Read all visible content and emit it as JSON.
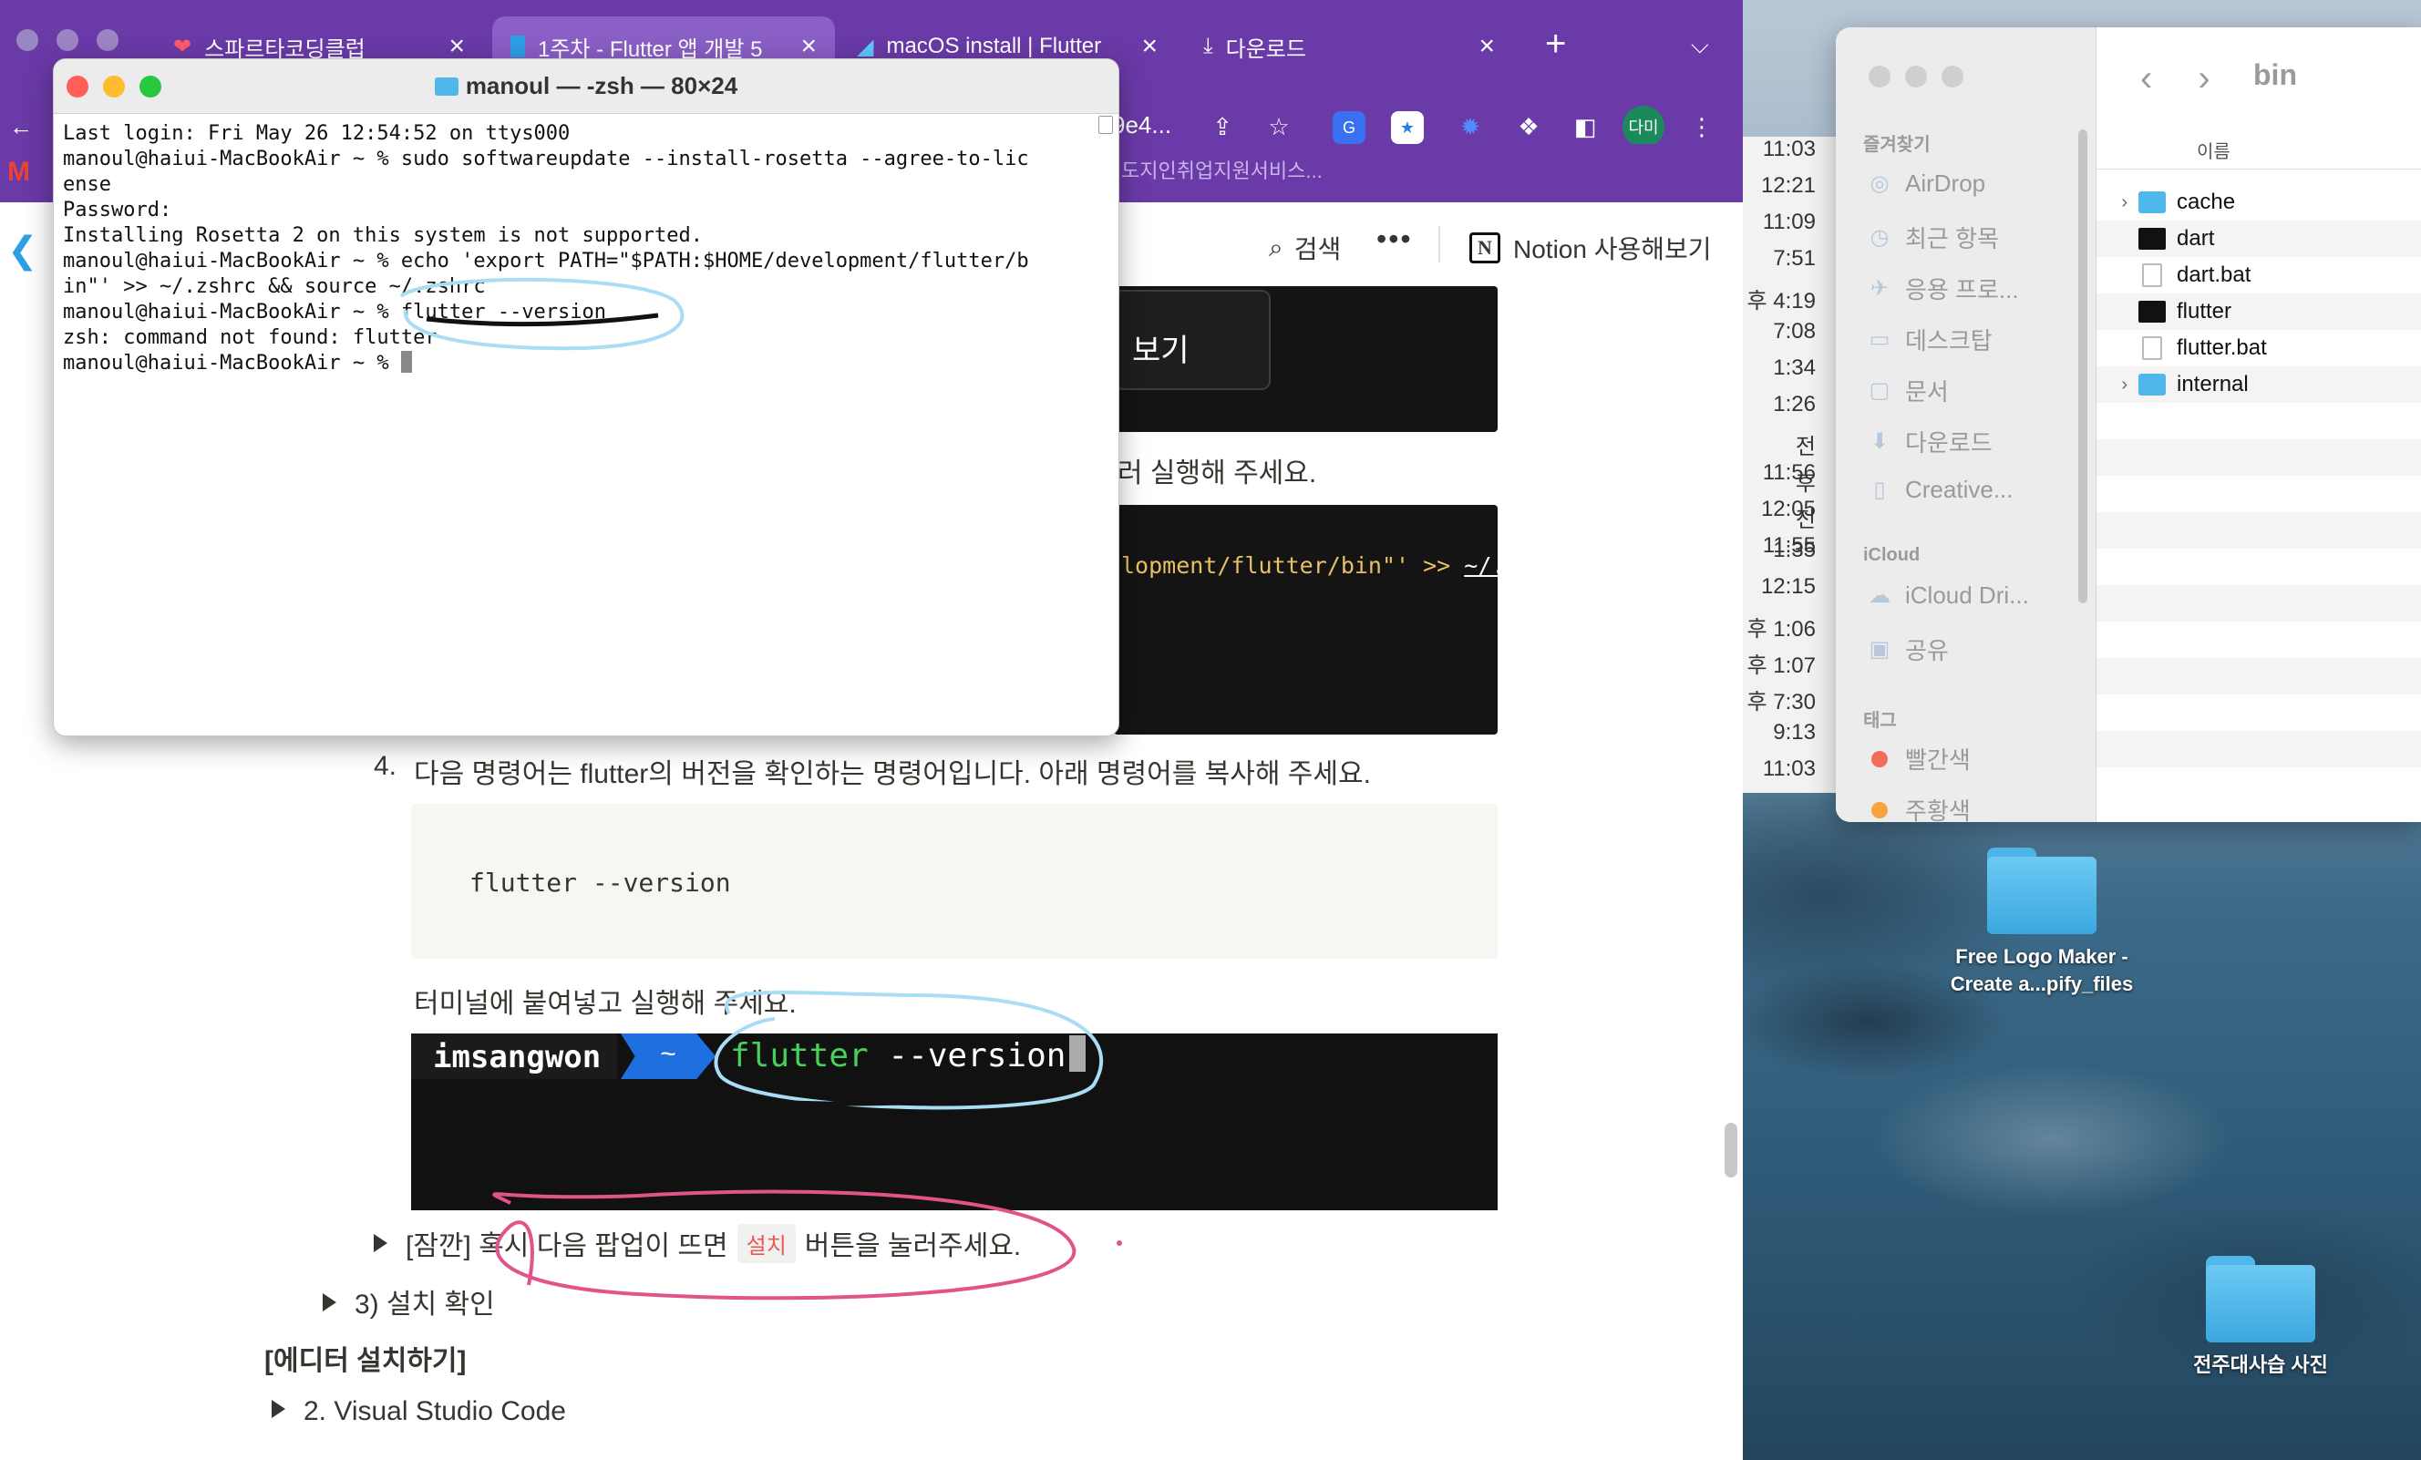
{
  "browser": {
    "tabs": [
      {
        "label": "스파르타코딩클럽",
        "icon": "sparta-icon"
      },
      {
        "label": "1주차 - Flutter 앱 개발 5",
        "icon": "notion-page-icon"
      },
      {
        "label": "macOS install | Flutter",
        "icon": "flutter-icon"
      },
      {
        "label": "다운로드",
        "icon": "download-icon"
      }
    ],
    "address_fragment": "9e4...",
    "profile_label": "다미",
    "bookmark_text": "도지인취업지원서비스..."
  },
  "notion": {
    "topbar": {
      "search_label": "검색",
      "more_label": "•••",
      "notion_label": "Notion 사용해보기",
      "notion_logo": "N"
    },
    "popup_button": "보기",
    "run_text_fragment": "러 실행해 주세요.",
    "code_fragment_1": "lopment/flutter/bin\"' >> ",
    "code_fragment_2": "~/.",
    "step4_number": "4.",
    "step4_text": "다음 명령어는 flutter의 버전을 확인하는 명령어입니다. 아래 명령어를 복사해 주세요.",
    "code_block": "flutter --version",
    "paste_text": "터미널에 붙여넣고 실행해 주세요.",
    "prompt_user": "imsangwon",
    "prompt_dir": "~",
    "prompt_cmd_1": "flutter",
    "prompt_cmd_2": " --version",
    "toggle_popup_text_1": "[잠깐] 혹시 다음 팝업이 뜨면",
    "toggle_popup_code": "설치",
    "toggle_popup_text_2": "버튼을 눌러주세요.",
    "toggle_install_check": "3) 설치 확인",
    "editor_heading": "[에디터 설치하기]",
    "toggle_vscode": "2. Visual Studio Code"
  },
  "history_times": [
    "11:03",
    "12:21",
    "11:09",
    "7:51",
    "후 4:19",
    "7:08",
    "1:34",
    "1:26",
    "전 11:56",
    "후 12:05",
    "전 11:55",
    "1:35",
    "12:15",
    "후 1:06",
    "후 1:07",
    "후 7:30",
    "9:13",
    "11:03"
  ],
  "terminal": {
    "title": "manoul — -zsh — 80×24",
    "lines": [
      "Last login: Fri May 26 12:54:52 on ttys000",
      "manoul@haiui-MacBookAir ~ % sudo softwareupdate --install-rosetta --agree-to-lic",
      "ense",
      "Password:",
      "Installing Rosetta 2 on this system is not supported.",
      "manoul@haiui-MacBookAir ~ % echo 'export PATH=\"$PATH:$HOME/development/flutter/b",
      "in\"' >> ~/.zshrc && source ~/.zshrc",
      "manoul@haiui-MacBookAir ~ % flutter --version",
      "zsh: command not found: flutter",
      "manoul@haiui-MacBookAir ~ % "
    ]
  },
  "finder": {
    "path": "bin",
    "column_header": "이름",
    "sections": {
      "favorites": "즐겨찾기",
      "icloud": "iCloud",
      "tags": "태그"
    },
    "favorites": [
      {
        "label": "AirDrop",
        "icon": "airdrop-icon"
      },
      {
        "label": "최근 항목",
        "icon": "clock-icon"
      },
      {
        "label": "응용 프로...",
        "icon": "applications-icon"
      },
      {
        "label": "데스크탑",
        "icon": "desktop-icon"
      },
      {
        "label": "문서",
        "icon": "document-icon"
      },
      {
        "label": "다운로드",
        "icon": "download-icon"
      },
      {
        "label": "Creative...",
        "icon": "file-icon"
      }
    ],
    "icloud": [
      {
        "label": "iCloud Dri...",
        "icon": "cloud-icon"
      },
      {
        "label": "공유",
        "icon": "shared-folder-icon"
      }
    ],
    "tags": [
      {
        "label": "빨간색",
        "color": "#f26b5b"
      },
      {
        "label": "주황색",
        "color": "#f6a33b"
      }
    ],
    "files": [
      {
        "name": "cache",
        "kind": "folder"
      },
      {
        "name": "dart",
        "kind": "exec"
      },
      {
        "name": "dart.bat",
        "kind": "doc"
      },
      {
        "name": "flutter",
        "kind": "exec"
      },
      {
        "name": "flutter.bat",
        "kind": "doc"
      },
      {
        "name": "internal",
        "kind": "folder"
      }
    ]
  },
  "desktop": {
    "icons": [
      {
        "label": "Free Logo Maker - Create a...pify_files"
      },
      {
        "label": "전주대사습 사진"
      }
    ]
  },
  "colors": {
    "tab_bar": "#6a3aa8",
    "annotation_blue": "#a9dcf5",
    "annotation_pink": "#e2538b",
    "flutter_blue": "#2e9fe6"
  }
}
